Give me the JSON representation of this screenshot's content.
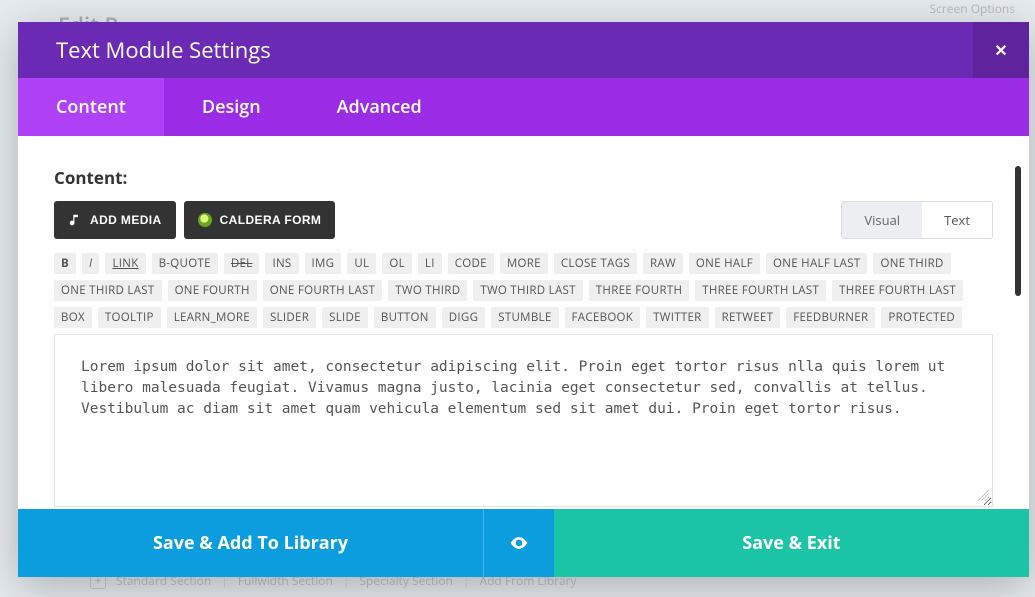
{
  "bg": {
    "top_left": "Edit P",
    "top_right": "Screen Options",
    "bottom_items": [
      "Standard Section",
      "Fullwidth Section",
      "Specialty Section",
      "Add From Library"
    ]
  },
  "modal": {
    "title": "Text Module Settings",
    "close_glyph": "✕"
  },
  "tabs": {
    "content": "Content",
    "design": "Design",
    "advanced": "Advanced"
  },
  "field_label": "Content:",
  "buttons": {
    "add_media": "ADD MEDIA",
    "caldera_form": "CALDERA FORM"
  },
  "mode": {
    "visual": "Visual",
    "text": "Text"
  },
  "tags": [
    {
      "label": "B",
      "style": "bold"
    },
    {
      "label": "I",
      "style": "italic"
    },
    {
      "label": "LINK",
      "style": "link"
    },
    {
      "label": "B-QUOTE"
    },
    {
      "label": "DEL",
      "style": "strike"
    },
    {
      "label": "INS"
    },
    {
      "label": "IMG"
    },
    {
      "label": "UL"
    },
    {
      "label": "OL"
    },
    {
      "label": "LI"
    },
    {
      "label": "CODE"
    },
    {
      "label": "MORE"
    },
    {
      "label": "CLOSE TAGS"
    },
    {
      "label": "RAW"
    },
    {
      "label": "ONE HALF"
    },
    {
      "label": "ONE HALF LAST"
    },
    {
      "label": "ONE THIRD"
    },
    {
      "label": "ONE THIRD LAST"
    },
    {
      "label": "ONE FOURTH"
    },
    {
      "label": "ONE FOURTH LAST"
    },
    {
      "label": "TWO THIRD"
    },
    {
      "label": "TWO THIRD LAST"
    },
    {
      "label": "THREE FOURTH"
    },
    {
      "label": "THREE FOURTH LAST"
    },
    {
      "label": "THREE FOURTH LAST"
    },
    {
      "label": "BOX"
    },
    {
      "label": "TOOLTIP"
    },
    {
      "label": "LEARN_MORE"
    },
    {
      "label": "SLIDER"
    },
    {
      "label": "SLIDE"
    },
    {
      "label": "BUTTON"
    },
    {
      "label": "DIGG"
    },
    {
      "label": "STUMBLE"
    },
    {
      "label": "FACEBOOK"
    },
    {
      "label": "TWITTER"
    },
    {
      "label": "RETWEET"
    },
    {
      "label": "FEEDBURNER"
    },
    {
      "label": "PROTECTED"
    }
  ],
  "editor_text": "Lorem ipsum dolor sit amet, consectetur adipiscing elit. Proin eget tortor risus nlla quis lorem ut libero malesuada feugiat. Vivamus magna justo, lacinia eget consectetur sed, convallis at tellus. Vestibulum ac diam sit amet quam vehicula elementum sed sit amet dui. Proin eget tortor risus.",
  "footer": {
    "save_library": "Save & Add To Library",
    "save_exit": "Save & Exit"
  }
}
